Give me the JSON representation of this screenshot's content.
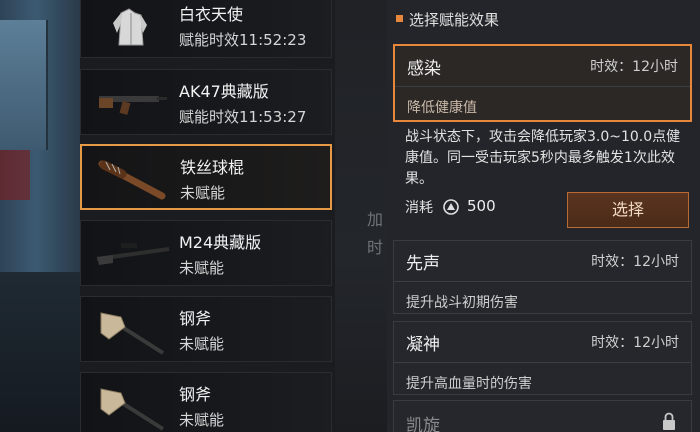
{
  "weapons": [
    {
      "name": "白衣天使",
      "status": "赋能时效11:52:23",
      "icon": "white-coat-icon"
    },
    {
      "name": "AK47典藏版",
      "status": "赋能时效11:53:27",
      "icon": "ak47-icon"
    },
    {
      "name": "铁丝球棍",
      "status": "未赋能",
      "icon": "wire-bat-icon",
      "selected": true
    },
    {
      "name": "M24典藏版",
      "status": "未赋能",
      "icon": "sniper-rifle-icon"
    },
    {
      "name": "钢斧",
      "status": "未赋能",
      "icon": "axe-icon"
    },
    {
      "name": "钢斧",
      "status": "未赋能",
      "icon": "axe-icon"
    }
  ],
  "background": {
    "ghost1": "加",
    "ghost2": "时"
  },
  "panel": {
    "title": "选择赋能效果",
    "effects": [
      {
        "name": "感染",
        "duration": "时效：12小时",
        "desc": "降低健康值",
        "selected": true
      },
      {
        "name": "先声",
        "duration": "时效：12小时",
        "desc": "提升战斗初期伤害"
      },
      {
        "name": "凝神",
        "duration": "时效：12小时",
        "desc": "提升高血量时的伤害"
      },
      {
        "name": "凯旋",
        "locked": true
      }
    ],
    "detail": {
      "text": "战斗状态下，攻击会降低玩家3.0~10.0点健康值。同一受击玩家5秒内最多触发1次此效果。",
      "cost_label": "消耗",
      "cost_value": "500",
      "cost_icon": "currency-icon",
      "select_label": "选择"
    }
  },
  "colors": {
    "accent": "#e7873b",
    "panel_bg": "#23252a",
    "button_bg": "#5a3520"
  }
}
